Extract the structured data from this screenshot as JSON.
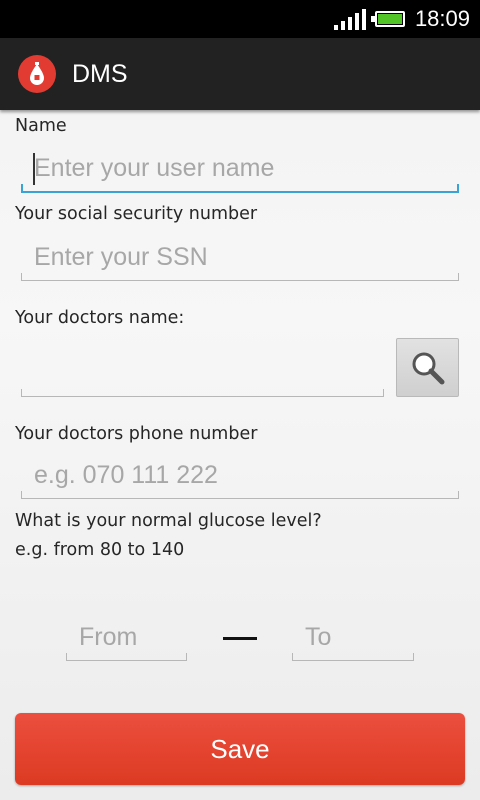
{
  "status_bar": {
    "time": "18:09"
  },
  "action_bar": {
    "title": "DMS",
    "icon": "blood-drop-icon",
    "icon_color": "#e23b32"
  },
  "form": {
    "name_label": "Name",
    "name_placeholder": "Enter your user name",
    "ssn_label": "Your social security number",
    "ssn_placeholder": "Enter your SSN",
    "doctor_name_label": "Your doctors name:",
    "doctor_phone_label": "Your doctors phone number",
    "doctor_phone_placeholder": "e.g. 070 111 222",
    "glucose_question": "What is your normal glucose level?",
    "glucose_hint": "e.g. from 80 to 140",
    "from_placeholder": "From",
    "to_placeholder": "To",
    "save_label": "Save"
  },
  "colors": {
    "accent": "#3aa3d6",
    "save_button": "#e5452f"
  }
}
